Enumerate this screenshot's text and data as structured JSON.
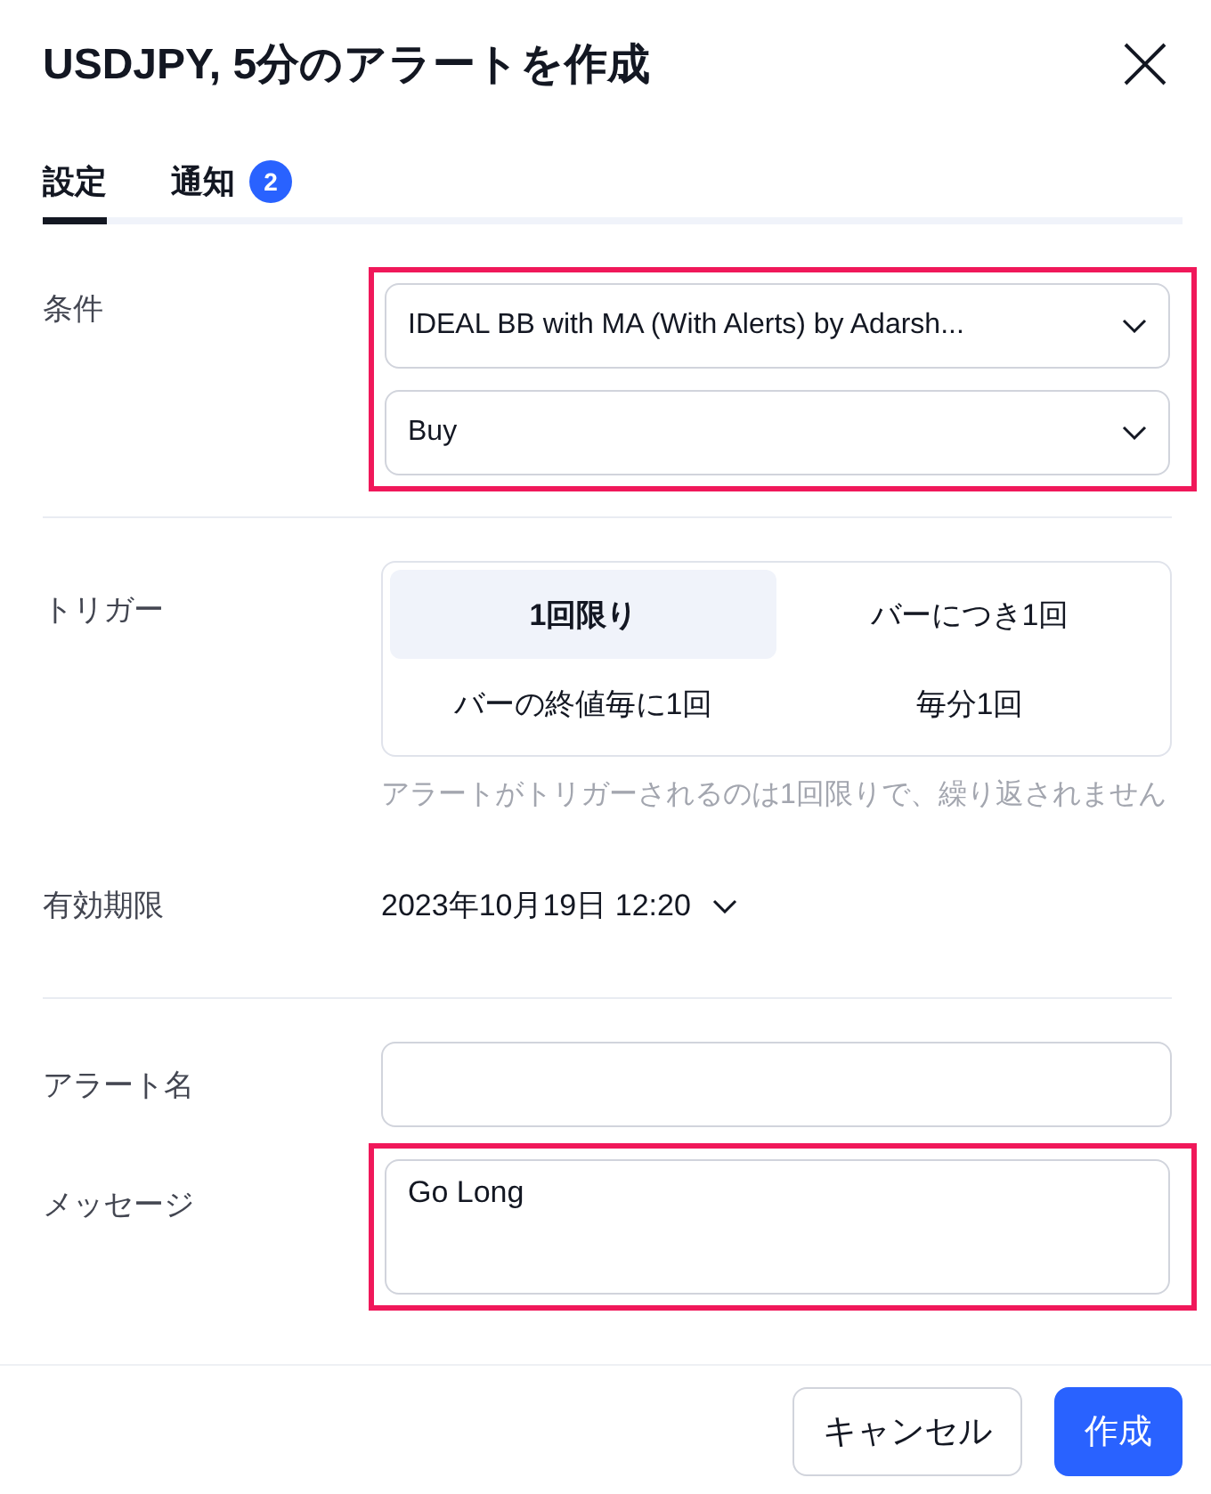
{
  "dialog": {
    "title": "USDJPY, 5分のアラートを作成"
  },
  "tabs": [
    {
      "label": "設定",
      "selected": true
    },
    {
      "label": "通知",
      "selected": false,
      "badge": "2"
    }
  ],
  "condition": {
    "label": "条件",
    "selects": [
      "IDEAL BB with MA (With Alerts) by Adarsh...",
      "Buy"
    ]
  },
  "trigger": {
    "label": "トリガー",
    "options": [
      {
        "label": "1回限り",
        "selected": true
      },
      {
        "label": "バーにつき1回",
        "selected": false
      },
      {
        "label": "バーの終値毎に1回",
        "selected": false
      },
      {
        "label": "毎分1回",
        "selected": false
      }
    ],
    "hint": "アラートがトリガーされるのは1回限りで、繰り返されません"
  },
  "expiration": {
    "label": "有効期限",
    "value": "2023年10月19日 12:20"
  },
  "alert_name": {
    "label": "アラート名"
  },
  "message": {
    "label": "メッセージ",
    "value": "Go Long"
  },
  "buttons": [
    {
      "label": "キャンセル",
      "kind": "secondary"
    },
    {
      "label": "作成",
      "kind": "primary"
    }
  ]
}
